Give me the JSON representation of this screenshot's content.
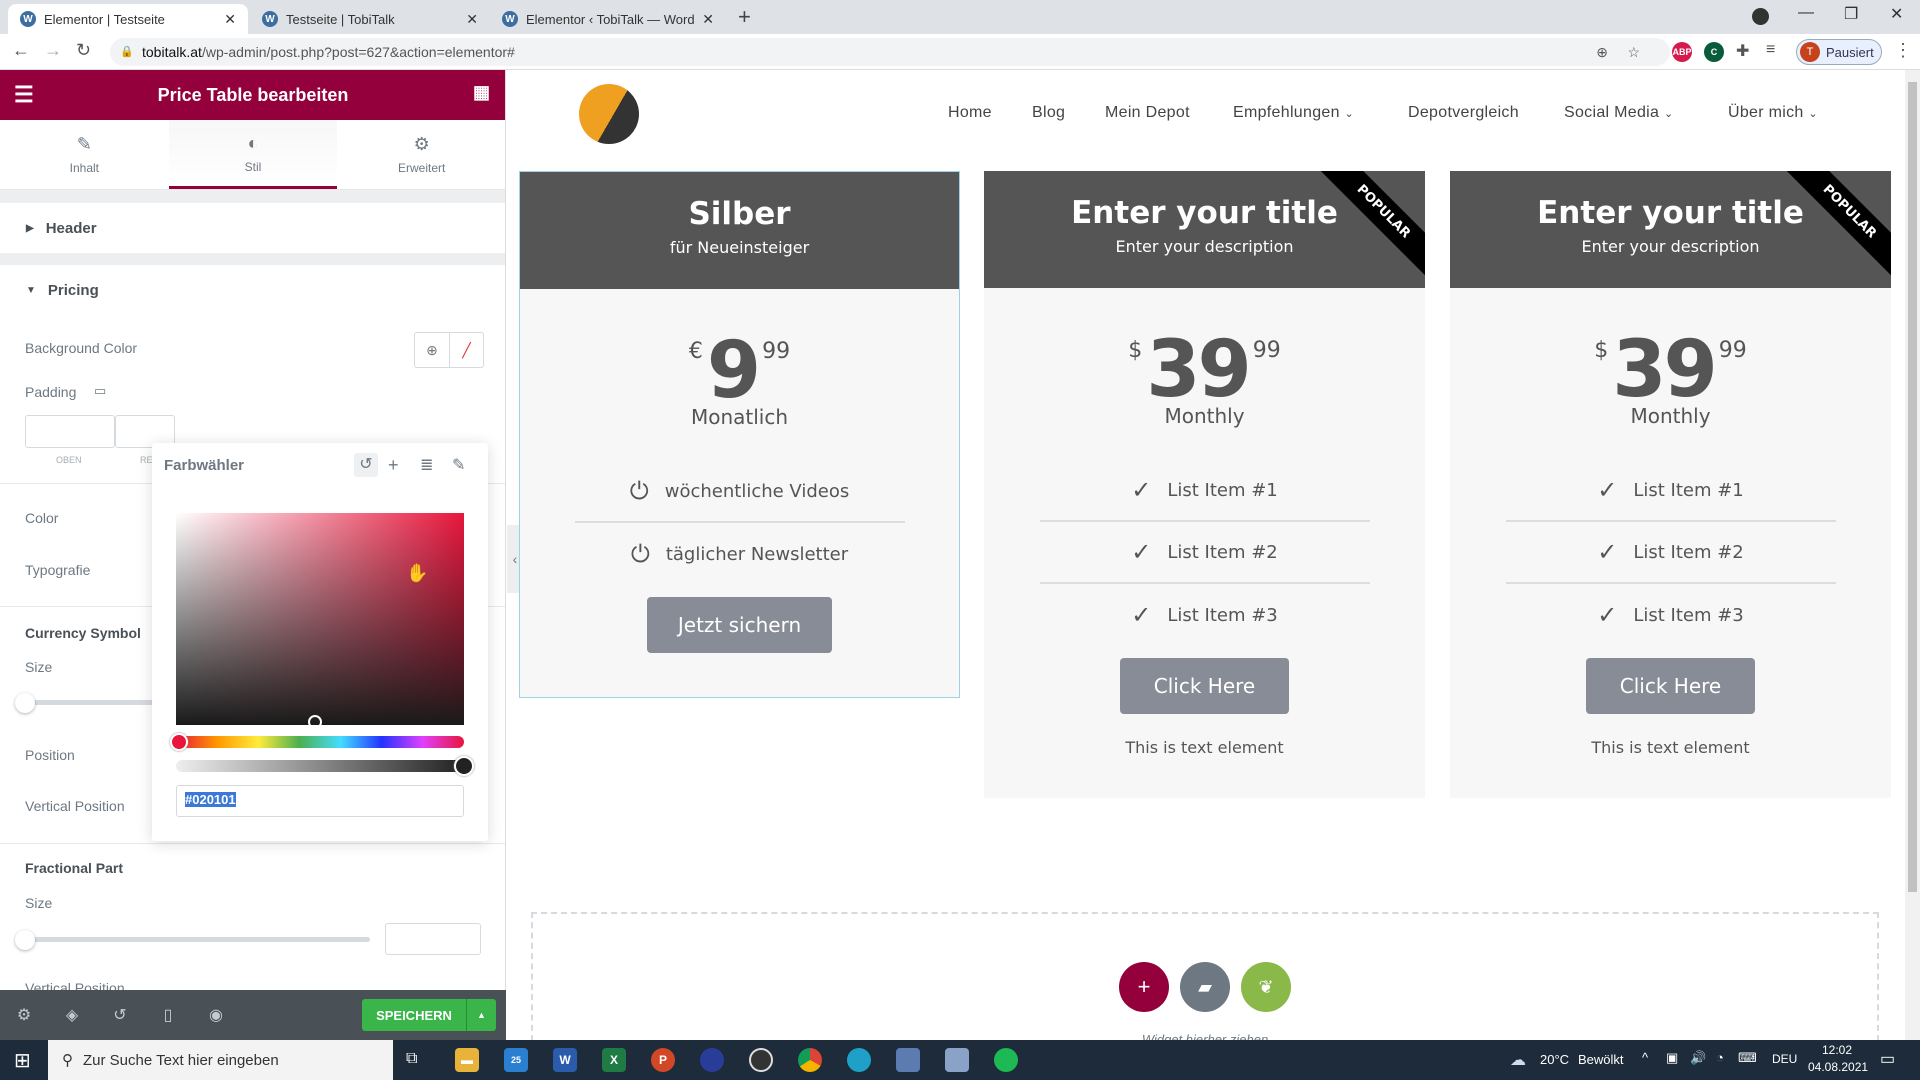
{
  "browser": {
    "tabs": [
      {
        "title": "Elementor | Testseite"
      },
      {
        "title": "Testseite | TobiTalk"
      },
      {
        "title": "Elementor ‹ TobiTalk — WordPress"
      }
    ],
    "url_host": "tobitalk.at",
    "url_path": "/wp-admin/post.php?post=627&action=elementor#",
    "profile_initial": "T",
    "profile_label": "Pausiert",
    "ext_abp": "ABP"
  },
  "sidebar": {
    "title": "Price Table bearbeiten",
    "tabs": [
      {
        "label": "Inhalt",
        "icon": "pencil"
      },
      {
        "label": "Stil",
        "icon": "contrast"
      },
      {
        "label": "Erweitert",
        "icon": "gear"
      }
    ],
    "sections": {
      "header": "Header",
      "pricing": "Pricing"
    },
    "fields": {
      "background_color": "Background Color",
      "padding": "Padding",
      "padding_top": "OBEN",
      "padding_right": "RE",
      "color": "Color",
      "typography": "Typografie",
      "currency_symbol": "Currency Symbol",
      "size": "Size",
      "position": "Position",
      "vertical_position": "Vertical Position",
      "fractional_part": "Fractional Part",
      "size2": "Size",
      "vertical_position2": "Vertical Position"
    },
    "save_label": "SPEICHERN"
  },
  "color_picker": {
    "title": "Farbwähler",
    "hex_value": "#020101",
    "hue_color": "#e8163c"
  },
  "canvas": {
    "nav": [
      "Home",
      "Blog",
      "Mein Depot",
      "Empfehlungen",
      "Depotvergleich",
      "Social Media",
      "Über mich"
    ],
    "cards": [
      {
        "title": "Silber",
        "description": "für Neueinsteiger",
        "currency": "€",
        "integer": "9",
        "fraction": "99",
        "period": "Monatlich",
        "features": [
          "wöchentliche Videos",
          "täglicher Newsletter"
        ],
        "button": "Jetzt sichern",
        "ribbon": "",
        "footer": ""
      },
      {
        "title": "Enter your title",
        "description": "Enter your description",
        "currency": "$",
        "integer": "39",
        "fraction": "99",
        "period": "Monthly",
        "features": [
          "List Item #1",
          "List Item #2",
          "List Item #3"
        ],
        "button": "Click Here",
        "ribbon": "POPULAR",
        "footer": "This is text element"
      },
      {
        "title": "Enter your title",
        "description": "Enter your description",
        "currency": "$",
        "integer": "39",
        "fraction": "99",
        "period": "Monthly",
        "features": [
          "List Item #1",
          "List Item #2",
          "List Item #3"
        ],
        "button": "Click Here",
        "ribbon": "POPULAR",
        "footer": "This is text element"
      }
    ],
    "drop_hint": "Widget hierher ziehen"
  },
  "taskbar": {
    "search_placeholder": "Zur Suche Text hier eingeben",
    "mail_badge": "25",
    "weather": "20°C",
    "weather_text": "Bewölkt",
    "lang": "DEU",
    "time": "12:02",
    "date": "04.08.2021"
  }
}
